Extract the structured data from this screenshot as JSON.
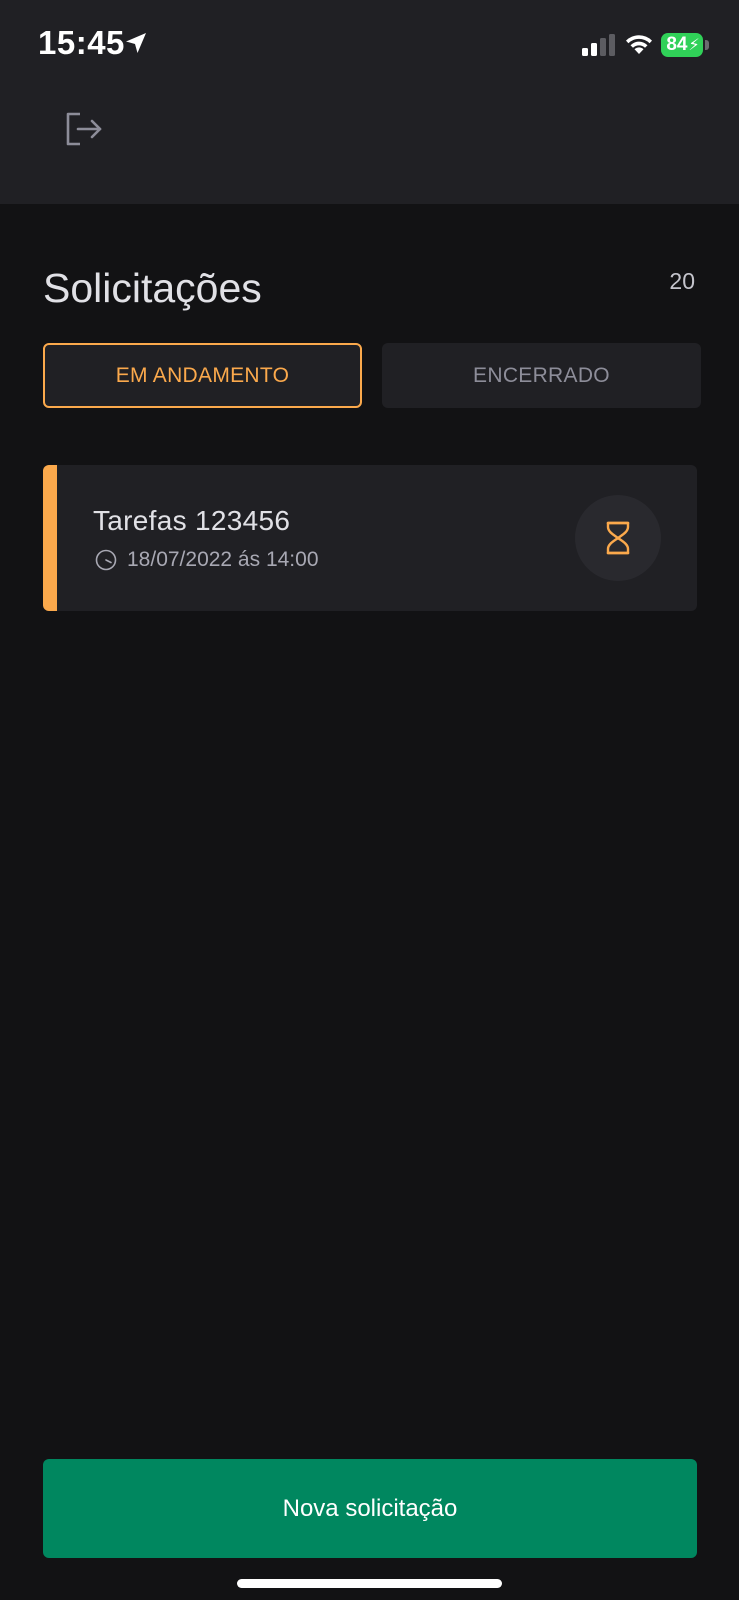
{
  "status_bar": {
    "time": "15:45",
    "battery": "84",
    "icons": [
      "location-arrow-icon",
      "cellular-signal-icon",
      "wifi-icon",
      "battery-charging-icon"
    ]
  },
  "header": {
    "logout_icon": "logout-icon"
  },
  "page": {
    "title": "Solicitações",
    "count": "20"
  },
  "tabs": [
    {
      "label": "EM ANDAMENTO",
      "active": true
    },
    {
      "label": "ENCERRADO",
      "active": false
    }
  ],
  "requests": [
    {
      "title": "Tarefas 123456",
      "date": "18/07/2022 ás 14:00",
      "status_icon": "hourglass-icon"
    }
  ],
  "actions": {
    "new_request": "Nova solicitação"
  },
  "colors": {
    "background": "#121214",
    "surface": "#202024",
    "accent_orange": "#fba94c",
    "primary_green": "#00875f",
    "battery_green": "#30d158"
  }
}
